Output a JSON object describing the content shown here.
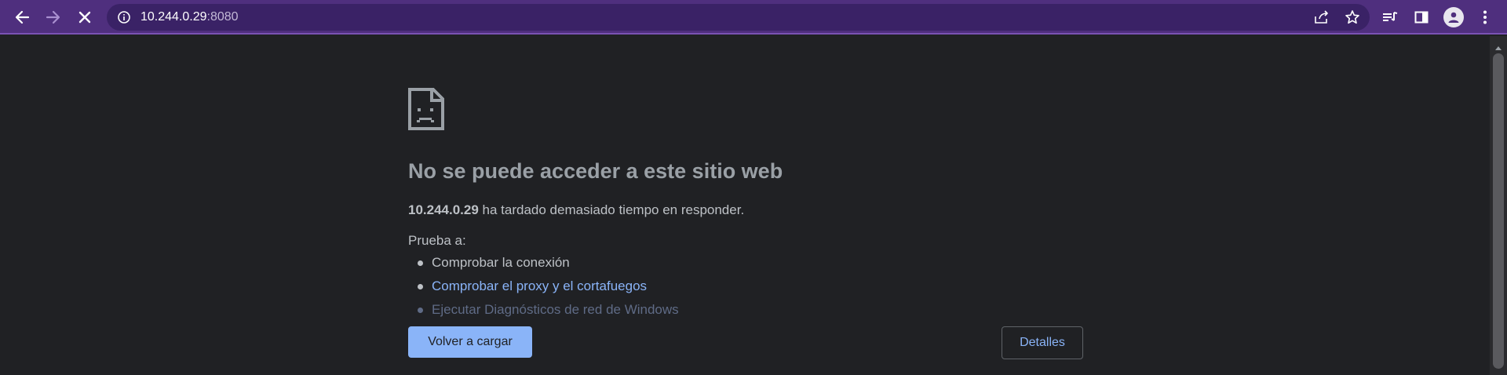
{
  "toolbar": {
    "url_host": "10.244.0.29",
    "url_port": ":8080",
    "icons": {
      "back": "back-arrow-icon",
      "forward": "forward-arrow-icon",
      "stop": "stop-loading-icon",
      "site_info": "info-icon",
      "share": "share-icon",
      "bookmark": "star-icon",
      "reading_list": "reading-list-icon",
      "side_panel": "side-panel-icon",
      "profile": "profile-avatar-icon",
      "menu": "kebab-menu-icon"
    }
  },
  "error": {
    "heading": "No se puede acceder a este sitio web",
    "host": "10.244.0.29",
    "message": "ha tardado demasiado tiempo en responder.",
    "try_label": "Prueba a:",
    "suggestions": [
      "Comprobar la conexión",
      "Comprobar el proxy y el cortafuegos",
      "Ejecutar Diagnósticos de red de Windows"
    ],
    "reload_label": "Volver a cargar",
    "details_label": "Detalles"
  },
  "colors": {
    "toolbar": "#4f2f7e",
    "page_background": "#202124",
    "link": "#8ab4f8",
    "primary_button": "#8ab4f8"
  }
}
